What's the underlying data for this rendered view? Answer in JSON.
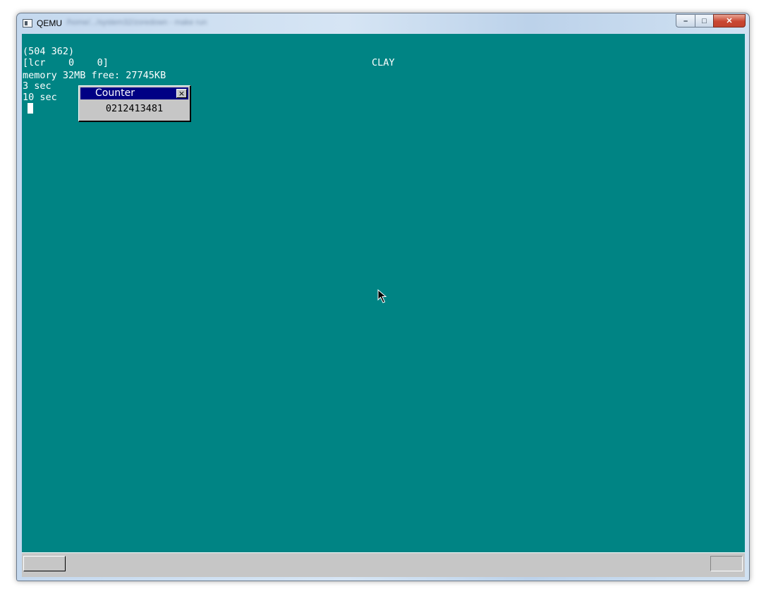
{
  "window": {
    "app_title": "QEMU",
    "subtitle_blurred": "/home/.../system32/zoredown - make run",
    "minimize_glyph": "–",
    "maximize_glyph": "□",
    "close_glyph": "✕"
  },
  "guest": {
    "background_color": "#008484",
    "mouse_coords": "(504 362)",
    "key_status": "[lcr    0    0]",
    "memory_line": "memory 32MB free: 27745KB",
    "timer_3": "3 sec",
    "timer_10": "10 sec",
    "os_label": "CLAY"
  },
  "counter_window": {
    "title": "Counter",
    "close_glyph": "×",
    "value": "0212413481"
  },
  "icons": {
    "app_icon": "qemu-window-icon",
    "pointer": "arrow-cursor-icon"
  }
}
